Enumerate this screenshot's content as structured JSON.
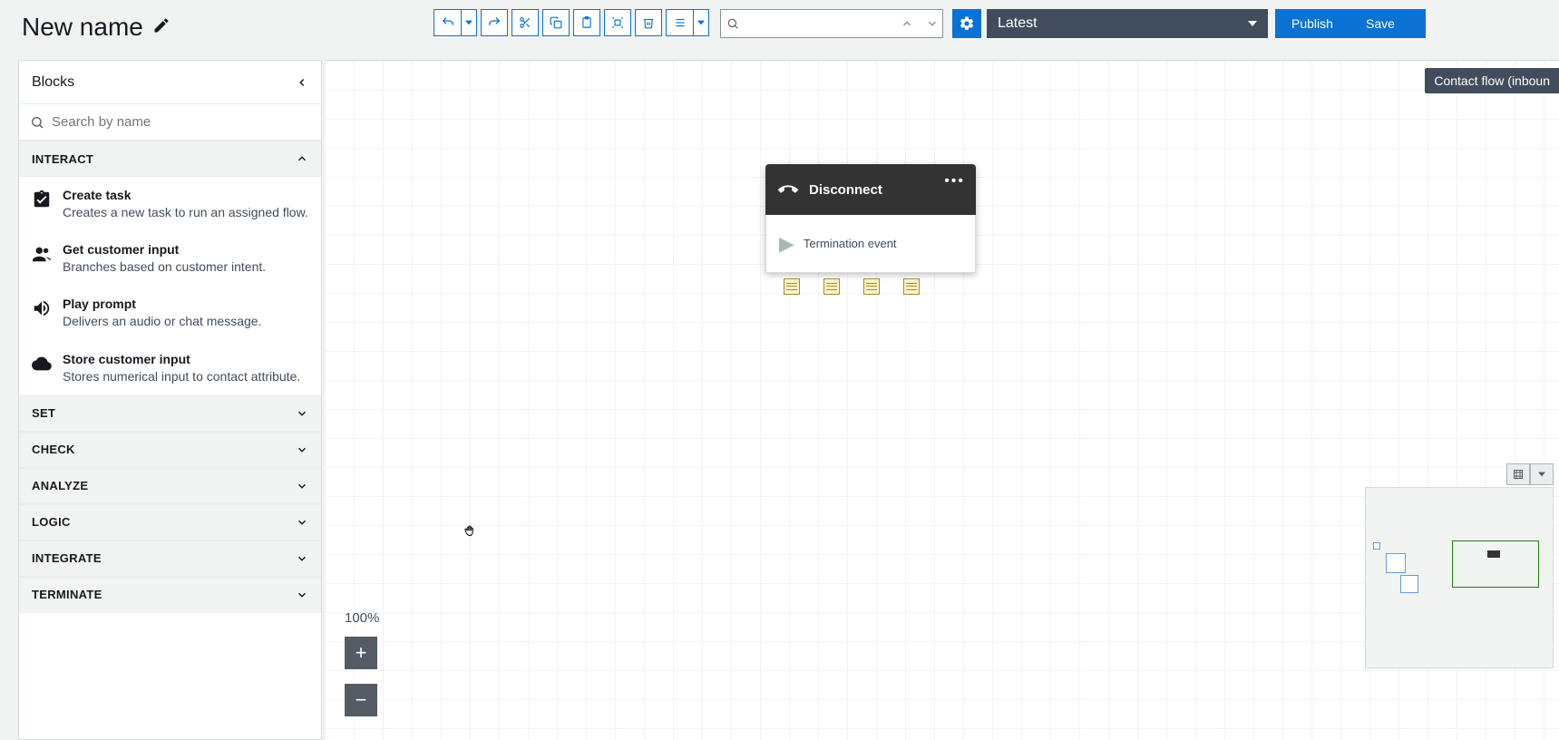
{
  "header": {
    "title": "New name",
    "version_label": "Latest",
    "publish_label": "Publish",
    "save_label": "Save"
  },
  "flow_badge": "Contact flow (inboun",
  "sidebar": {
    "title": "Blocks",
    "search_placeholder": "Search by name",
    "sections": [
      {
        "label": "INTERACT",
        "expanded": true
      },
      {
        "label": "SET",
        "expanded": false
      },
      {
        "label": "CHECK",
        "expanded": false
      },
      {
        "label": "ANALYZE",
        "expanded": false
      },
      {
        "label": "LOGIC",
        "expanded": false
      },
      {
        "label": "INTEGRATE",
        "expanded": false
      },
      {
        "label": "TERMINATE",
        "expanded": false
      }
    ],
    "interact_blocks": [
      {
        "title": "Create task",
        "desc": "Creates a new task to run an assigned flow."
      },
      {
        "title": "Get customer input",
        "desc": "Branches based on customer intent."
      },
      {
        "title": "Play prompt",
        "desc": "Delivers an audio or chat message."
      },
      {
        "title": "Store customer input",
        "desc": "Stores numerical input to contact attribute."
      }
    ]
  },
  "canvas": {
    "node": {
      "title": "Disconnect",
      "body": "Termination event"
    },
    "zoom_label": "100%"
  }
}
